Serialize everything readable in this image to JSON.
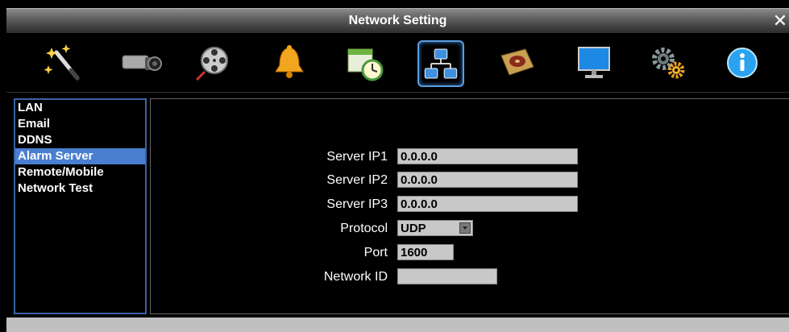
{
  "window": {
    "title": "Network Setting",
    "close_glyph": "✕"
  },
  "toolbar": {
    "icons": [
      {
        "name": "wizard-wand-icon"
      },
      {
        "name": "camera-icon"
      },
      {
        "name": "film-reel-icon"
      },
      {
        "name": "alarm-bell-icon"
      },
      {
        "name": "schedule-clock-icon"
      },
      {
        "name": "network-icon"
      },
      {
        "name": "hard-disk-icon"
      },
      {
        "name": "monitor-icon"
      },
      {
        "name": "gear-settings-icon"
      },
      {
        "name": "info-icon"
      }
    ],
    "active": "network-icon"
  },
  "sidebar": {
    "items": [
      {
        "label": "LAN"
      },
      {
        "label": "Email"
      },
      {
        "label": "DDNS"
      },
      {
        "label": "Alarm Server"
      },
      {
        "label": "Remote/Mobile"
      },
      {
        "label": "Network Test"
      }
    ],
    "selected": "Alarm Server"
  },
  "form": {
    "server_ip1": {
      "label": "Server IP1",
      "value": "0.0.0.0"
    },
    "server_ip2": {
      "label": "Server IP2",
      "value": "0.0.0.0"
    },
    "server_ip3": {
      "label": "Server IP3",
      "value": "0.0.0.0"
    },
    "protocol": {
      "label": "Protocol",
      "value": "UDP"
    },
    "port": {
      "label": "Port",
      "value": "1600"
    },
    "network_id": {
      "label": "Network ID",
      "value": ""
    }
  },
  "colors": {
    "selection": "#4a7fd0",
    "panel_border": "#3a63a8",
    "field_bg": "#c8c8c8"
  }
}
